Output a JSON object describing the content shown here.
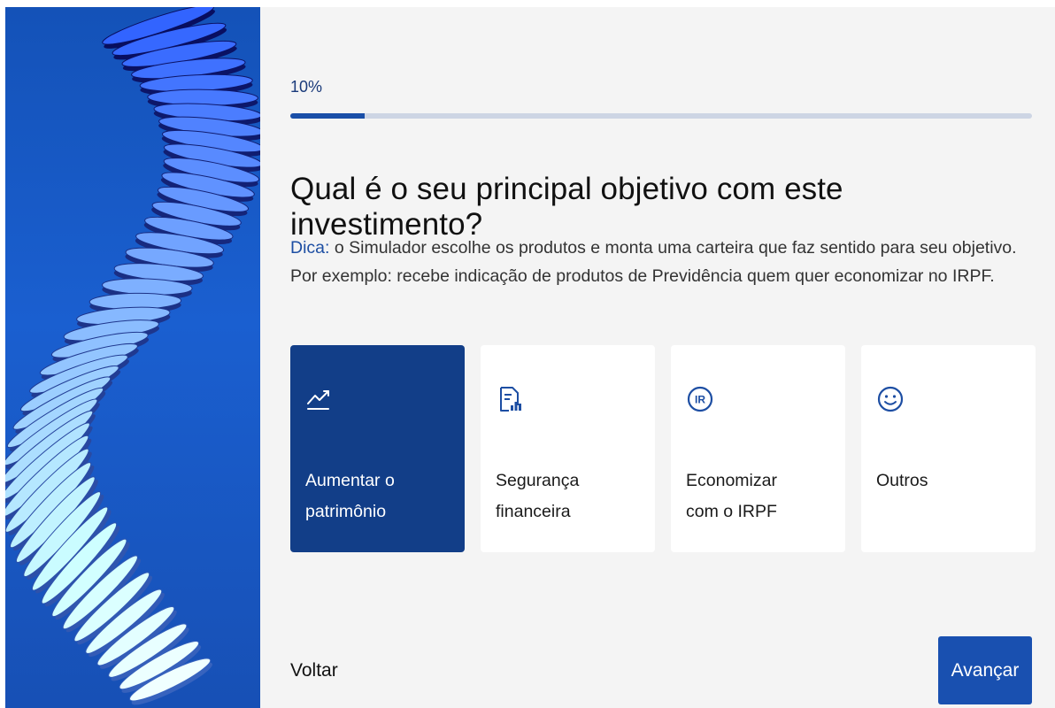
{
  "progress": {
    "label": "10%",
    "value": 0.1
  },
  "question": {
    "title": "Qual é o seu principal objetivo com este investimento?"
  },
  "hint": {
    "label": "Dica:",
    "text": " o Simulador escolhe os produtos e monta uma carteira que faz sentido para seu objetivo. Por exemplo: recebe indicação de produtos de Previdência quem quer economizar no IRPF."
  },
  "options": [
    {
      "line1": "Aumentar o",
      "line2": "patrimônio",
      "icon": "trending-up-icon",
      "selected": true
    },
    {
      "line1": "Segurança",
      "line2": "financeira",
      "icon": "document-chart-icon",
      "selected": false
    },
    {
      "line1": "Economizar",
      "line2": "com o IRPF",
      "icon": "ir-badge-icon",
      "icon_text": "IR",
      "selected": false
    },
    {
      "line1": "Outros",
      "line2": "",
      "icon": "smiley-icon",
      "selected": false
    }
  ],
  "navigation": {
    "back_label": "Voltar",
    "next_label": "Avançar"
  },
  "colors": {
    "accent": "#1950b0",
    "selected_card": "#123e88",
    "progress_fill": "#1a4fa8",
    "progress_track": "#cdd5e4",
    "background": "#f4f4f4"
  }
}
